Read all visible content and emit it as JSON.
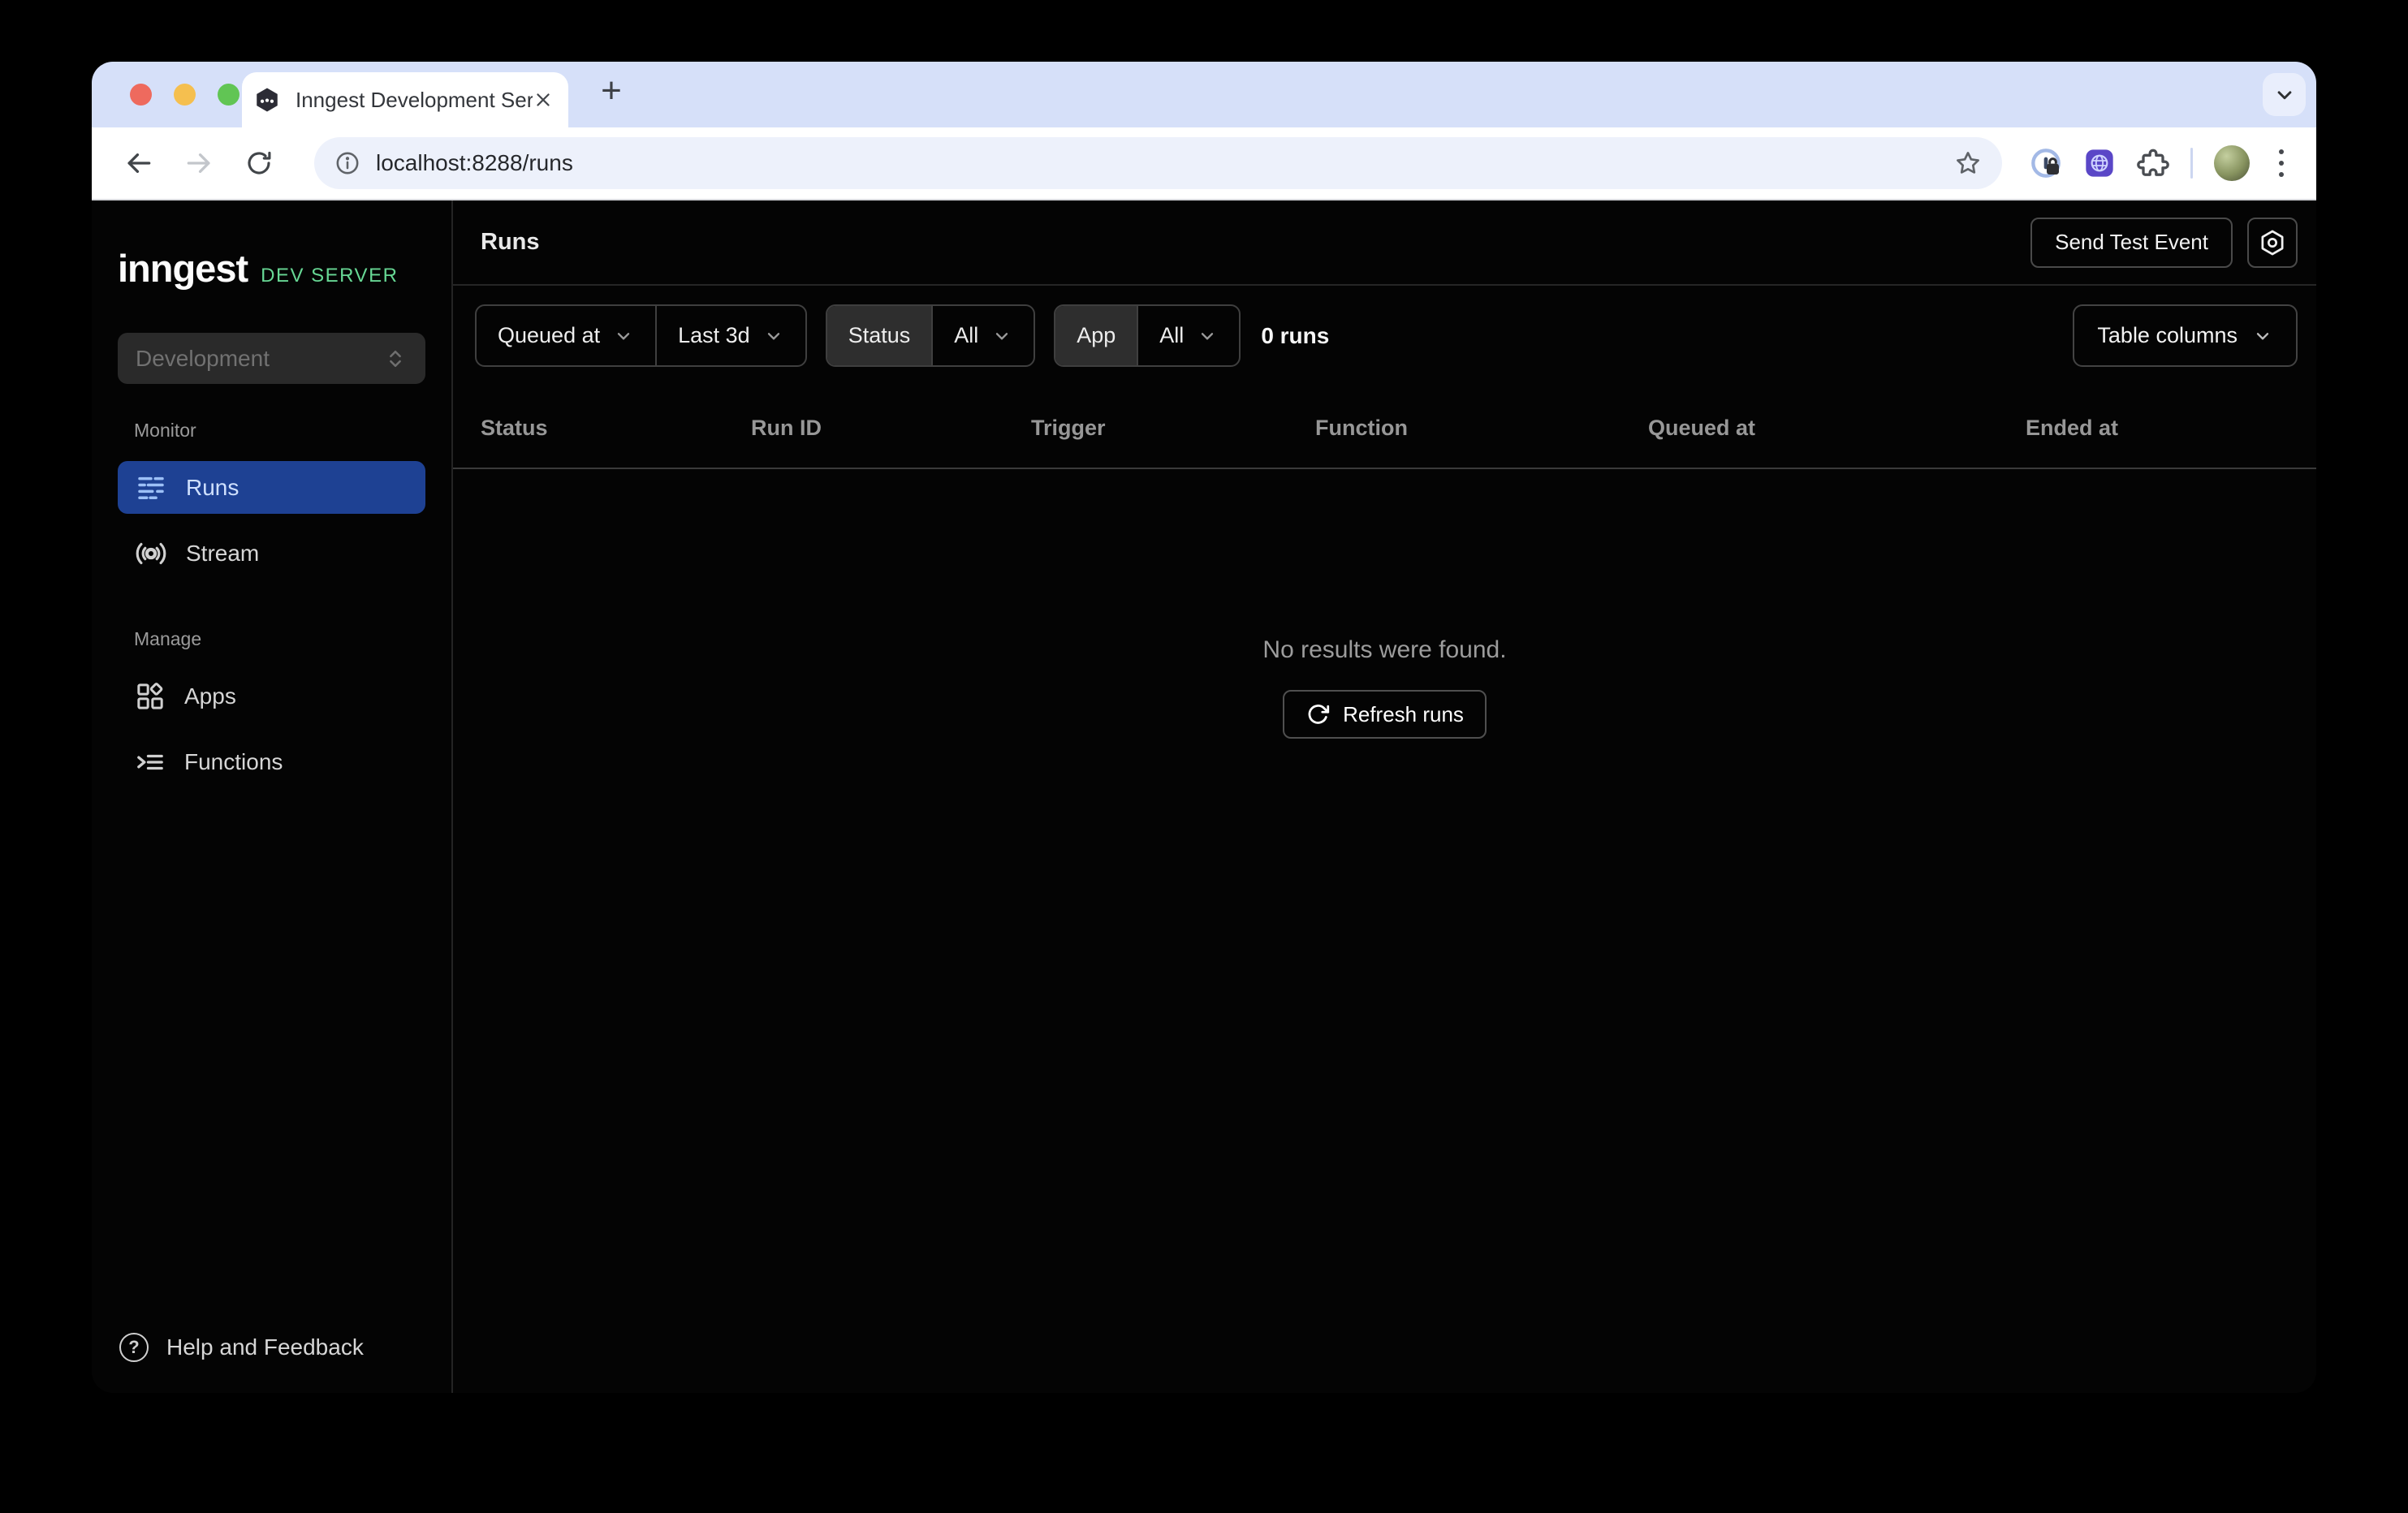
{
  "colors": {
    "accent_blue": "#1e4193",
    "brand_green": "#67d794",
    "tab_strip": "#d6e0f9",
    "toolbar": "#ffffff",
    "url_pill": "#edf1fb",
    "page_bg": "#040404",
    "traffic_red": "#ee6a5e",
    "traffic_yellow": "#f5bf4f",
    "traffic_green": "#61c554"
  },
  "icons": {
    "plus": "+",
    "question": "?"
  },
  "browser": {
    "tab_title": "Inngest Development Server",
    "url": "localhost:8288/runs"
  },
  "sidebar": {
    "logo_text": "inngest",
    "logo_badge": "DEV SERVER",
    "env_select": {
      "value": "Development"
    },
    "sections": [
      {
        "label": "Monitor",
        "items": [
          {
            "label": "Runs"
          },
          {
            "label": "Stream"
          }
        ]
      },
      {
        "label": "Manage",
        "items": [
          {
            "label": "Apps"
          },
          {
            "label": "Functions"
          }
        ]
      }
    ],
    "help_label": "Help and Feedback"
  },
  "main": {
    "title": "Runs",
    "send_test_event": "Send Test Event",
    "filters": {
      "field": "Queued at",
      "range": "Last 3d",
      "status_label": "Status",
      "status_value": "All",
      "app_label": "App",
      "app_value": "All",
      "count": "0 runs",
      "table_columns": "Table columns"
    },
    "table": {
      "columns": [
        "Status",
        "Run ID",
        "Trigger",
        "Function",
        "Queued at",
        "Ended at"
      ]
    },
    "empty": {
      "message": "No results were found.",
      "refresh": "Refresh runs"
    }
  }
}
